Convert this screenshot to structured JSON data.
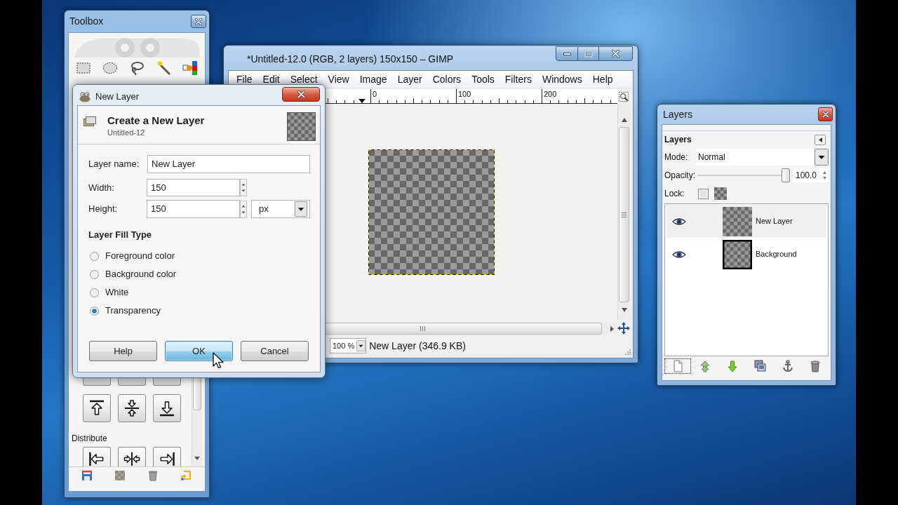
{
  "toolbox": {
    "title": "Toolbox",
    "section_label": "Distribute"
  },
  "image_window": {
    "title": "*Untitled-12.0 (RGB, 2 layers) 150x150 – GIMP",
    "menu": [
      "File",
      "Edit",
      "Select",
      "View",
      "Image",
      "Layer",
      "Colors",
      "Tools",
      "Filters",
      "Windows",
      "Help"
    ],
    "ruler_labels": [
      "0",
      "100",
      "200"
    ],
    "zoom": "100 %",
    "status": "New Layer (346.9 KB)"
  },
  "new_layer_dialog": {
    "title": "New Layer",
    "heading": "Create a New Layer",
    "subheading": "Untitled-12",
    "layer_name": {
      "label": "Layer name:",
      "value": "New Layer"
    },
    "width": {
      "label": "Width:",
      "value": "150"
    },
    "height": {
      "label": "Height:",
      "value": "150"
    },
    "unit": "px",
    "fill_type": {
      "heading": "Layer Fill Type",
      "options": [
        {
          "label": "Foreground color",
          "selected": false
        },
        {
          "label": "Background color",
          "selected": false
        },
        {
          "label": "White",
          "selected": false
        },
        {
          "label": "Transparency",
          "selected": true
        }
      ]
    },
    "buttons": [
      {
        "label": "Help",
        "focused": false
      },
      {
        "label": "OK",
        "focused": true
      },
      {
        "label": "Cancel",
        "focused": false
      }
    ]
  },
  "layers_dock": {
    "title": "Layers",
    "panel_title": "Layers",
    "mode": {
      "label": "Mode:",
      "value": "Normal"
    },
    "opacity": {
      "label": "Opacity:",
      "level": 1,
      "value": "100.0"
    },
    "lock": {
      "label": "Lock:",
      "checked": false
    },
    "layers": [
      {
        "name": "New Layer",
        "visible": true,
        "selected": true,
        "outlined": false
      },
      {
        "name": "Background",
        "visible": true,
        "selected": false,
        "outlined": true
      }
    ],
    "toolbar": [
      {
        "kind": "new",
        "focused": true
      },
      {
        "kind": "raise",
        "focused": false
      },
      {
        "kind": "lower",
        "focused": false
      },
      {
        "kind": "duplicate",
        "focused": false
      },
      {
        "kind": "anchor",
        "focused": false
      },
      {
        "kind": "delete",
        "focused": false
      }
    ]
  }
}
